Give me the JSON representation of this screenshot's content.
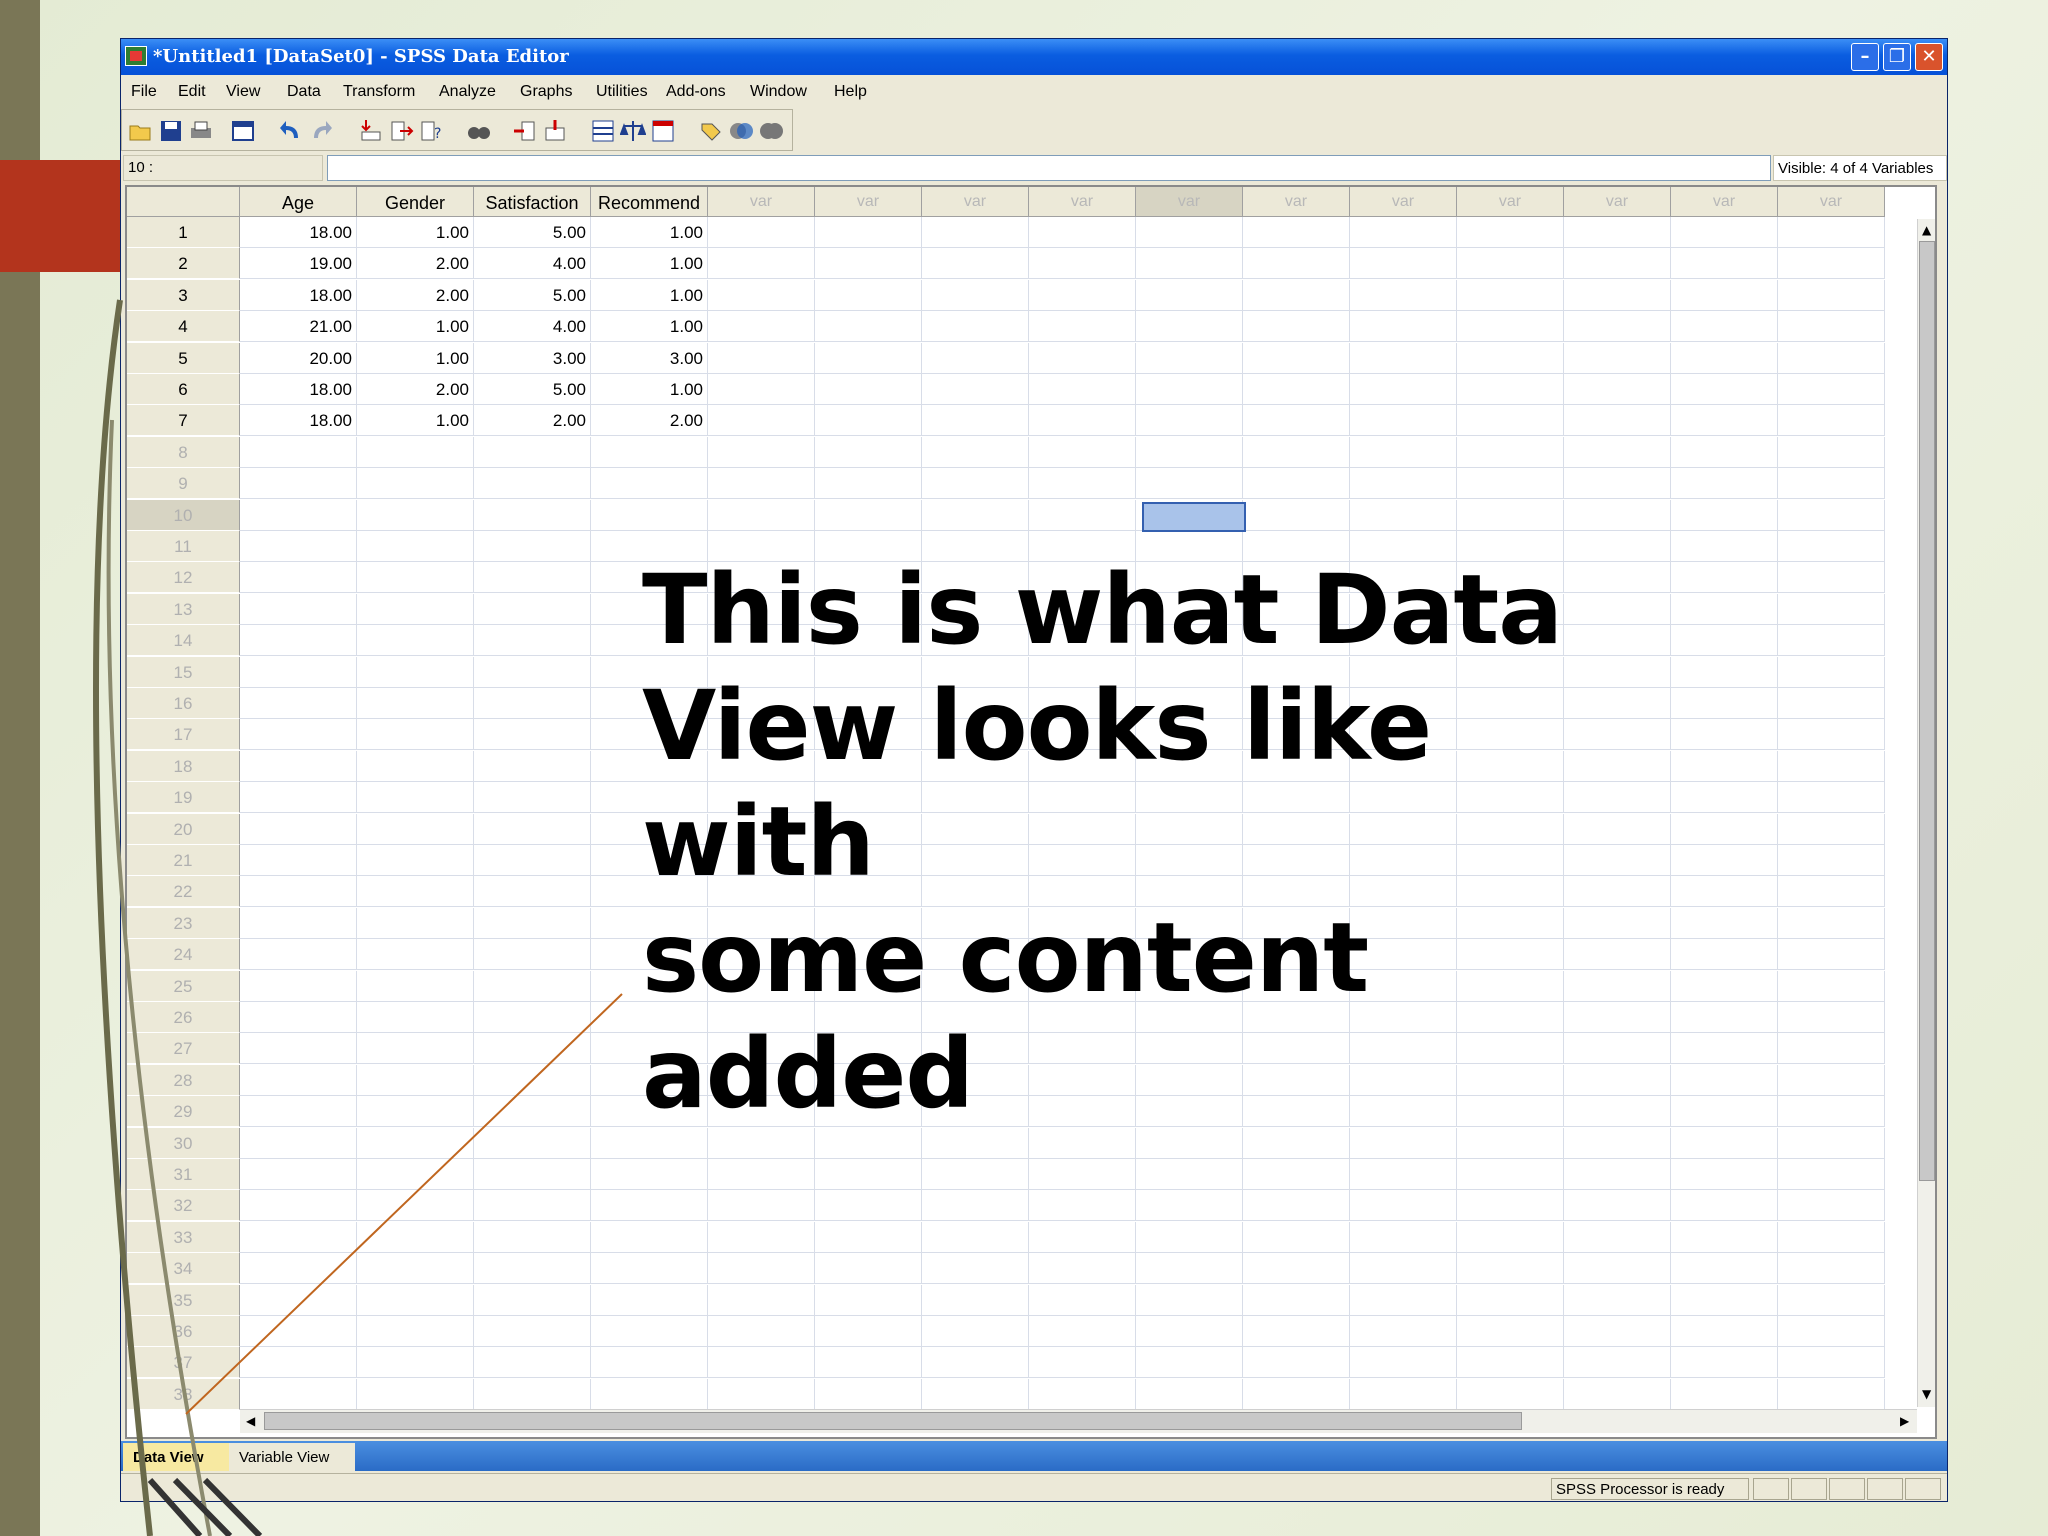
{
  "window": {
    "title": "*Untitled1 [DataSet0] - SPSS Data Editor",
    "controls": [
      "minimize-icon",
      "restore-icon",
      "close-icon"
    ]
  },
  "menu": [
    "File",
    "Edit",
    "View",
    "Data",
    "Transform",
    "Analyze",
    "Graphs",
    "Utilities",
    "Add-ons",
    "Window",
    "Help"
  ],
  "toolbar": {
    "icons": [
      "open-icon",
      "save-icon",
      "print-icon",
      "dialog-recall-icon",
      "undo-icon",
      "redo-icon",
      "goto-case-icon",
      "goto-variable-icon",
      "variables-icon",
      "find-icon",
      "insert-cases-icon",
      "insert-variable-icon",
      "split-file-icon",
      "weight-cases-icon",
      "select-cases-icon",
      "value-labels-icon",
      "use-sets-icon",
      "show-all-icon"
    ]
  },
  "cellbar": {
    "cell_ref": "10 :",
    "cell_value": "",
    "visible": "Visible: 4 of 4 Variables"
  },
  "grid": {
    "columns": [
      "Age",
      "Gender",
      "Satisfaction",
      "Recommend",
      "var",
      "var",
      "var",
      "var",
      "var",
      "var",
      "var",
      "var",
      "var",
      "var",
      "var"
    ],
    "rows": [
      [
        "18.00",
        "1.00",
        "5.00",
        "1.00"
      ],
      [
        "19.00",
        "2.00",
        "4.00",
        "1.00"
      ],
      [
        "18.00",
        "2.00",
        "5.00",
        "1.00"
      ],
      [
        "21.00",
        "1.00",
        "4.00",
        "1.00"
      ],
      [
        "20.00",
        "1.00",
        "3.00",
        "3.00"
      ],
      [
        "18.00",
        "2.00",
        "5.00",
        "1.00"
      ],
      [
        "18.00",
        "1.00",
        "2.00",
        "2.00"
      ]
    ],
    "row_numbers": [
      "1",
      "2",
      "3",
      "4",
      "5",
      "6",
      "7",
      "8",
      "9",
      "10",
      "11",
      "12",
      "13",
      "14",
      "15",
      "16",
      "17",
      "18",
      "19",
      "20",
      "21",
      "22",
      "23",
      "24",
      "25",
      "26",
      "27",
      "28",
      "29",
      "30",
      "31",
      "32",
      "33",
      "34",
      "35",
      "36",
      "37",
      "38"
    ],
    "selected_row": "10"
  },
  "tabs": {
    "data_view": "Data View",
    "variable_view": "Variable View"
  },
  "status": "SPSS  Processor is ready",
  "annotation": {
    "line1": "This is what Data",
    "line2": "View looks like with",
    "line3": "some content",
    "line4": "added"
  },
  "colors": {
    "titlebar": "#0a5de0",
    "active_tab": "#f7e9a1",
    "selection": "#a9c3ea",
    "slide_accent_red": "#b3341d",
    "slide_strip": "#7a7656",
    "callout_line": "#c0661f"
  }
}
